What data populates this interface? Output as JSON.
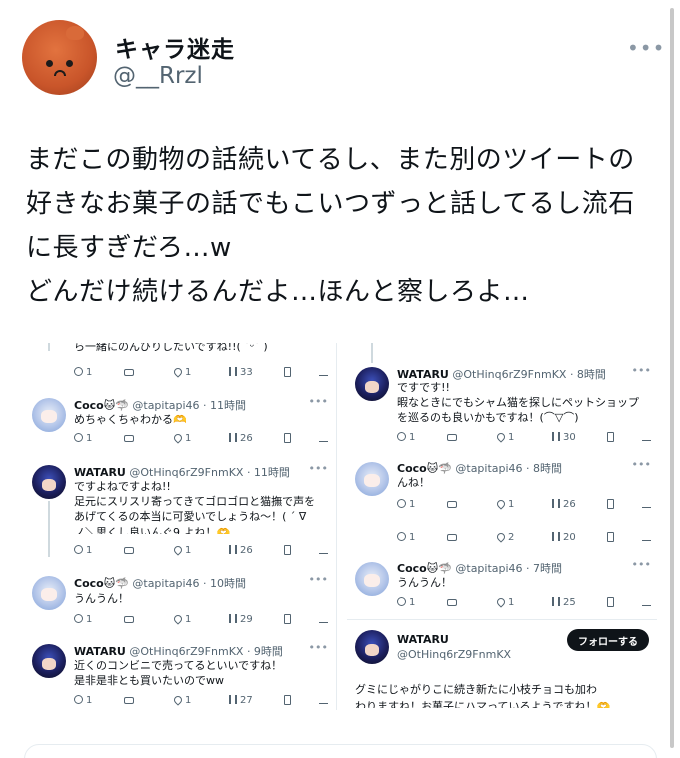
{
  "author": {
    "display_name": "キャラ迷走",
    "handle": "@__Rrzl",
    "more_label": "•••"
  },
  "tweet": {
    "lines": [
      "まだこの動物の話続いてるし、また別のツイートの",
      "好きなお菓子の話でもこいつずっと話してるし流石",
      "に長すぎだろ…w",
      "どんだけ続けるんだよ…ほんと察しろよ…"
    ]
  },
  "embed": {
    "left": {
      "top_fragment": "ら一緒にのんびりしたいですね!!( ˘ᵕ˘ )",
      "top_actions": {
        "reply": "1",
        "retweet": "",
        "like": "1",
        "views": "33"
      },
      "posts": [
        {
          "avatar": "coco-avatar",
          "name": "Coco🐱🦈",
          "handle_time": "@tapitapi46 · 11時間",
          "lines": [
            "めちゃくちゃわかる🫶"
          ],
          "actions": {
            "reply": "1",
            "retweet": "",
            "like": "1",
            "views": "26"
          }
        },
        {
          "avatar": "wataru-avatar",
          "name": "WATARU",
          "handle_time": "@OtHinq6rZ9FnmKX · 11時間",
          "lines": [
            "ですよねですよね!!",
            "足元にスリスリ寄ってきてゴロゴロと猫撫で声を",
            "あげてくるの本当に可愛いでしょうね〜！( ´ ∇"
          ],
          "cut_line": "ノ＼思くし良いんぐ9 よね！🫶",
          "actions": {
            "reply": "1",
            "retweet": "",
            "like": "1",
            "views": "26"
          }
        },
        {
          "avatar": "coco-avatar",
          "name": "Coco🐱🦈",
          "handle_time": "@tapitapi46 · 10時間",
          "lines": [
            "うんうん！"
          ],
          "actions": {
            "reply": "1",
            "retweet": "",
            "like": "1",
            "views": "29"
          }
        },
        {
          "avatar": "wataru-avatar",
          "name": "WATARU",
          "handle_time": "@OtHinq6rZ9FnmKX · 9時間",
          "lines": [
            "近くのコンビニで売ってるといいですね！",
            "是非是非とも買いたいのでww"
          ],
          "actions": {
            "reply": "1",
            "retweet": "",
            "like": "1",
            "views": "27"
          }
        }
      ]
    },
    "right": {
      "posts": [
        {
          "avatar": "wataru-avatar",
          "name": "WATARU",
          "handle_time": "@OtHinq6rZ9FnmKX · 8時間",
          "lines": [
            "ですです!!",
            "暇なときにでもシャム猫を探しにペットショップ",
            "を巡るのも良いかもですね！(⌒▽⌒)"
          ],
          "actions": {
            "reply": "1",
            "retweet": "",
            "like": "1",
            "views": "30"
          }
        },
        {
          "avatar": "coco-avatar",
          "name": "Coco🐱🦈",
          "handle_time": "@tapitapi46 · 8時間",
          "lines": [
            "んね！"
          ],
          "actions": {
            "reply": "1",
            "retweet": "",
            "like": "1",
            "views": "26"
          },
          "extra_actions": {
            "reply": "1",
            "retweet": "",
            "like": "2",
            "views": "20"
          }
        },
        {
          "avatar": "coco-avatar",
          "name": "Coco🐱🦈",
          "handle_time": "@tapitapi46 · 7時間",
          "lines": [
            "うんうん！"
          ],
          "actions": {
            "reply": "1",
            "retweet": "",
            "like": "1",
            "views": "25"
          }
        }
      ],
      "profile": {
        "name": "WATARU",
        "handle": "@OtHinq6rZ9FnmKX",
        "follow_label": "フォローする"
      },
      "bottom_lines": [
        "グミにじゃがりこに続き新たに小枝チョコも加わ",
        "わりますね！お菓子にハマっているようですね！🫶"
      ]
    }
  }
}
